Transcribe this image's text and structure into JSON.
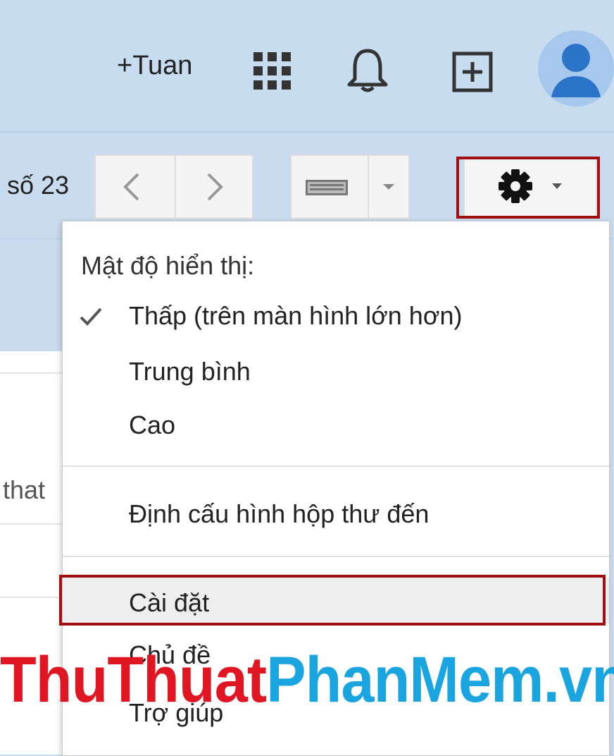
{
  "header": {
    "user_link": "+Tuan",
    "icons": [
      "apps-icon",
      "bell-icon",
      "share-icon",
      "avatar"
    ]
  },
  "toolbar": {
    "count_text": "số 23",
    "buttons": [
      "chevron-left-icon",
      "chevron-right-icon",
      "keyboard-icon",
      "chevron-down-icon",
      "gear-icon"
    ]
  },
  "mail": {
    "snippet": "that"
  },
  "menu": {
    "section_title": "Mật độ hiển thị:",
    "density_options": [
      {
        "label": "Thấp (trên màn hình lớn hơn)",
        "checked": true
      },
      {
        "label": "Trung bình",
        "checked": false
      },
      {
        "label": "Cao",
        "checked": false
      }
    ],
    "config_inbox": "Định cấu hình hộp thư đến",
    "settings": "Cài đặt",
    "themes": "Chủ đề",
    "help": "Trợ giúp"
  },
  "watermark": {
    "part1": "ThuThuat",
    "part2": "PhanMem.vn"
  },
  "colors": {
    "header_bg": "#c8dcf0",
    "highlight": "#a01010",
    "watermark_red": "#e01622",
    "watermark_blue": "#1aa5e0"
  }
}
